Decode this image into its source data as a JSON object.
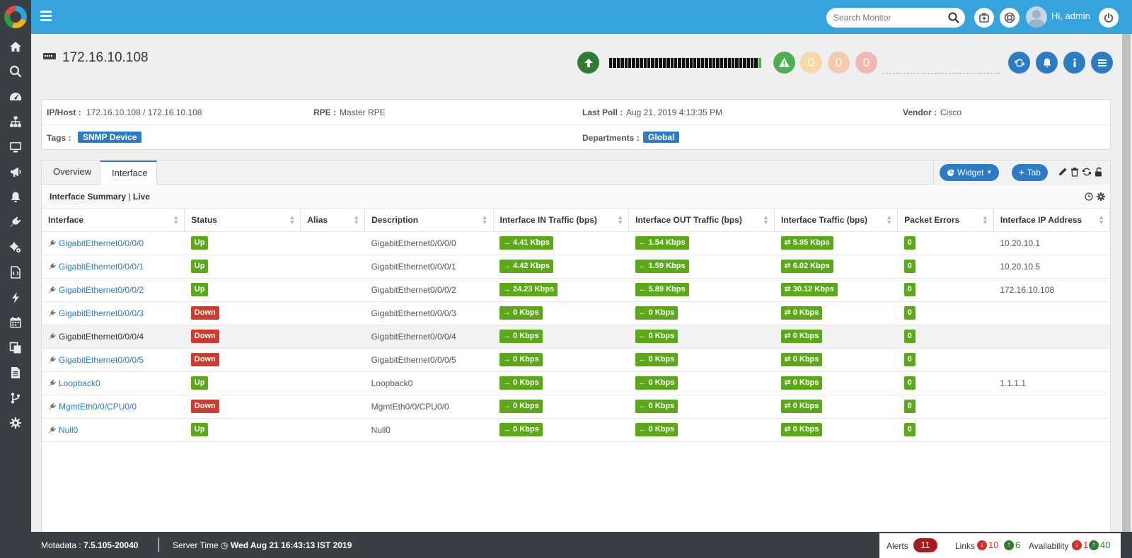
{
  "topbar": {
    "search_placeholder": "Search Monitor",
    "greeting": "Hi, admin",
    "accent": "#35a4dd"
  },
  "sidebar": {
    "items": [
      "home-icon",
      "search-icon",
      "dashboard-icon",
      "topology-icon",
      "monitor-icon",
      "campaign-icon",
      "alert-bell-icon",
      "plug-icon",
      "settings-gears-icon",
      "report-code-icon",
      "flash-icon",
      "calendar-icon",
      "copy-icon",
      "document-icon",
      "flow-icon",
      "gear-icon"
    ]
  },
  "header": {
    "title": "172.16.10.108",
    "severity_counts": [
      "0",
      "0",
      "0"
    ]
  },
  "info": {
    "ip_label": "IP/Host :",
    "ip_value": "172.16.10.108 / 172.16.10.108",
    "rpe_label": "RPE :",
    "rpe_value": "Master RPE",
    "poll_label": "Last Poll :",
    "poll_value": "Aug 21, 2019 4:13:35 PM",
    "vendor_label": "Vendor :",
    "vendor_value": "Cisco",
    "tags_label": "Tags :",
    "tag_value": "SNMP Device",
    "dept_label": "Departments :",
    "dept_value": "Global"
  },
  "tabs": {
    "overview": "Overview",
    "interface": "Interface",
    "widget_btn": "Widget",
    "tab_btn": "Tab"
  },
  "widget": {
    "title": "Interface Summary",
    "sep": "|",
    "mode": "Live"
  },
  "table": {
    "headers": [
      "Interface",
      "Status",
      "Alias",
      "Description",
      "Interface IN Traffic (bps)",
      "Interface OUT Traffic (bps)",
      "Interface Traffic (bps)",
      "Packet Errors",
      "Interface IP Address"
    ],
    "rows": [
      {
        "name": "GigabitEthernet0/0/0/0",
        "status": "Up",
        "alias": "",
        "desc": "GigabitEthernet0/0/0/0",
        "in": "4.41 Kbps",
        "out": "1.54 Kbps",
        "total": "5.95 Kbps",
        "errors": "0",
        "ip": "10.20.10.1"
      },
      {
        "name": "GigabitEthernet0/0/0/1",
        "status": "Up",
        "alias": "",
        "desc": "GigabitEthernet0/0/0/1",
        "in": "4.42 Kbps",
        "out": "1.59 Kbps",
        "total": "6.02 Kbps",
        "errors": "0",
        "ip": "10.20.10.5"
      },
      {
        "name": "GigabitEthernet0/0/0/2",
        "status": "Up",
        "alias": "",
        "desc": "GigabitEthernet0/0/0/2",
        "in": "24.23 Kbps",
        "out": "5.89 Kbps",
        "total": "30.12 Kbps",
        "errors": "0",
        "ip": "172.16.10.108"
      },
      {
        "name": "GigabitEthernet0/0/0/3",
        "status": "Down",
        "alias": "",
        "desc": "GigabitEthernet0/0/0/3",
        "in": "0 Kbps",
        "out": "0 Kbps",
        "total": "0 Kbps",
        "errors": "0",
        "ip": ""
      },
      {
        "name": "GigabitEthernet0/0/0/4",
        "status": "Down",
        "alias": "",
        "desc": "GigabitEthernet0/0/0/4",
        "in": "0 Kbps",
        "out": "0 Kbps",
        "total": "0 Kbps",
        "errors": "0",
        "ip": ""
      },
      {
        "name": "GigabitEthernet0/0/0/5",
        "status": "Down",
        "alias": "",
        "desc": "GigabitEthernet0/0/0/5",
        "in": "0 Kbps",
        "out": "0 Kbps",
        "total": "0 Kbps",
        "errors": "0",
        "ip": ""
      },
      {
        "name": "Loopback0",
        "status": "Up",
        "alias": "",
        "desc": "Loopback0",
        "in": "0 Kbps",
        "out": "0 Kbps",
        "total": "0 Kbps",
        "errors": "0",
        "ip": "1.1.1.1"
      },
      {
        "name": "MgmtEth0/0/CPU0/0",
        "status": "Down",
        "alias": "",
        "desc": "MgmtEth0/0/CPU0/0",
        "in": "0 Kbps",
        "out": "0 Kbps",
        "total": "0 Kbps",
        "errors": "0",
        "ip": ""
      },
      {
        "name": "Null0",
        "status": "Up",
        "alias": "",
        "desc": "Null0",
        "in": "0 Kbps",
        "out": "0 Kbps",
        "total": "0 Kbps",
        "errors": "0",
        "ip": ""
      }
    ]
  },
  "footer": {
    "version_label": "Motadata : ",
    "version": "7.5.105-20040",
    "server_time_label": "Server Time ",
    "server_time": "Wed Aug 21 16:43:13 IST 2019",
    "alerts_label": "Alerts",
    "alerts_count": "11",
    "links_label": "Links",
    "links_down": "10",
    "links_up": "6",
    "avail_label": "Availability",
    "avail_down": "1",
    "avail_up": "40"
  },
  "colors": {
    "up": "#5ba819",
    "down": "#cf3b2c",
    "brand_blue": "#2b7cc4",
    "sidebar": "#3a3f44"
  }
}
